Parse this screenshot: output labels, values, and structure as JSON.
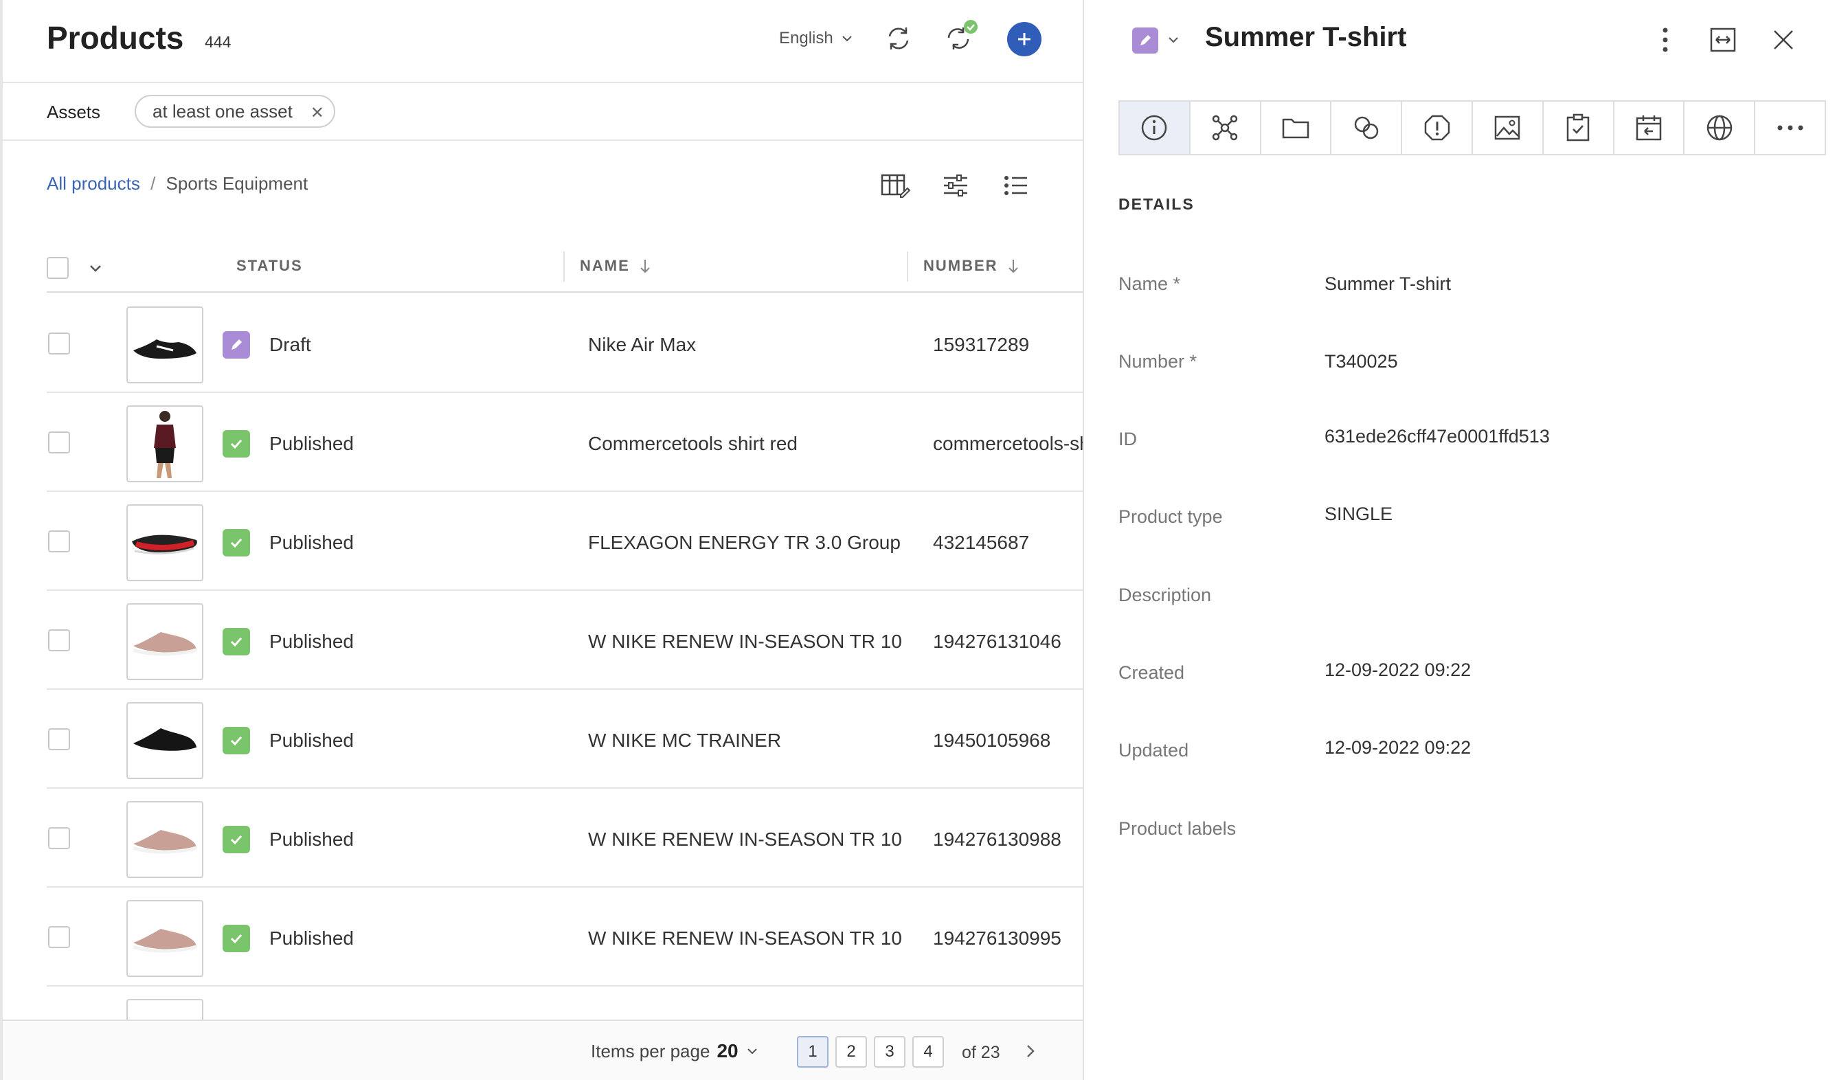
{
  "header": {
    "title": "Products",
    "count": "444",
    "language": "English"
  },
  "filter": {
    "label": "Assets",
    "chip": "at least one asset"
  },
  "breadcrumb": {
    "root": "All products",
    "separator": "/",
    "current": "Sports Equipment"
  },
  "table": {
    "columns": {
      "status": "STATUS",
      "name": "NAME",
      "number": "NUMBER"
    },
    "rows": [
      {
        "status": "Draft",
        "name": "Nike Air Max",
        "number": "159317289"
      },
      {
        "status": "Published",
        "name": "Commercetools shirt red",
        "number": "commercetools-shirt"
      },
      {
        "status": "Published",
        "name": "FLEXAGON ENERGY TR 3.0 Group",
        "number": "432145687"
      },
      {
        "status": "Published",
        "name": "W NIKE RENEW IN-SEASON TR 10",
        "number": "194276131046"
      },
      {
        "status": "Published",
        "name": "W NIKE MC TRAINER",
        "number": "19450105968"
      },
      {
        "status": "Published",
        "name": "W NIKE RENEW IN-SEASON TR 10",
        "number": "194276130988"
      },
      {
        "status": "Published",
        "name": "W NIKE RENEW IN-SEASON TR 10",
        "number": "194276130995"
      }
    ]
  },
  "pagination": {
    "items_label": "Items per page",
    "items_value": "20",
    "pages": [
      "1",
      "2",
      "3",
      "4"
    ],
    "of": "of 23"
  },
  "detail": {
    "title": "Summer T-shirt",
    "section": "DETAILS",
    "fields": [
      {
        "label": "Name *",
        "value": "Summer T-shirt"
      },
      {
        "label": "Number *",
        "value": "T340025"
      },
      {
        "label": "ID",
        "value": "631ede26cff47e0001ffd513"
      },
      {
        "label": "Product type",
        "value": "SINGLE"
      },
      {
        "label": "Description",
        "value": ""
      },
      {
        "label": "Created",
        "value": "12-09-2022 09:22"
      },
      {
        "label": "Updated",
        "value": "12-09-2022 09:22"
      },
      {
        "label": "Product labels",
        "value": ""
      }
    ]
  },
  "colors": {
    "accent": "#2f5db8",
    "published": "#7ac46b",
    "draft": "#a98bd6",
    "link": "#3a65b4"
  }
}
